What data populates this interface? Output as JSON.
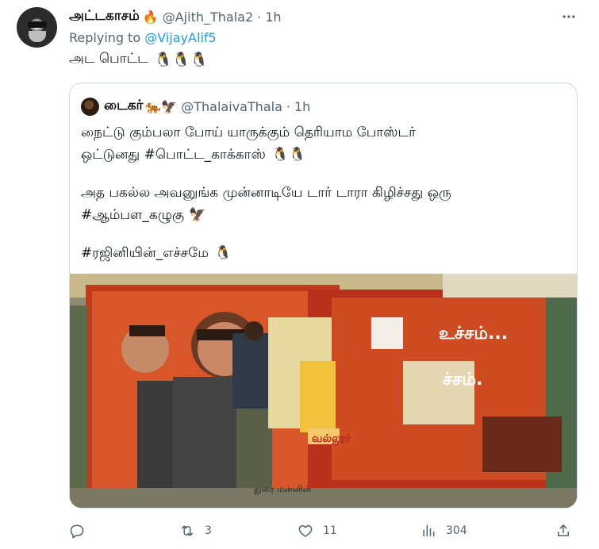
{
  "tweet": {
    "display_name": "அட்டகாசம்",
    "name_emoji": "🔥",
    "handle": "@Ajith_Thala2",
    "time": "1h",
    "replying_prefix": "Replying to ",
    "replying_to": "@VijayAlif5",
    "text": "அட பொட்ட",
    "text_emojis": "🐧🐧🐧"
  },
  "quoted": {
    "display_name": "டைகர்",
    "name_emojis": "🐅🦅",
    "handle": "@ThalaivaThala",
    "time": "1h",
    "line1": "நைட்டு கும்பலா போய் யாருக்கும் தெரியாம போஸ்டர்",
    "line2": "ஒட்டுனது #பொட்ட_காக்காஸ்",
    "line2_emojis": "🐧🐧",
    "line3": "அத பகல்ல அவனுங்க முன்னாடியே டார் டாரா கிழிச்சது ஒரு",
    "line4": "#ஆம்பள_கழுகு",
    "line4_emoji": "🦅",
    "line5": "#ரஜினியின்_எச்சமே",
    "line5_emoji": "🐧",
    "poster_text_1": "உச்சம்...",
    "poster_text_2": "ச்சம்.",
    "poster_text_3": "வல்லூர்",
    "poster_text_4": "துரை மன்னின்"
  },
  "actions": {
    "reply_count": "",
    "retweet_count": "3",
    "like_count": "11",
    "views_count": "304"
  },
  "colors": {
    "text": "#0f1419",
    "secondary": "#536471",
    "link": "#1d9bf0",
    "border": "#cfd9de"
  }
}
